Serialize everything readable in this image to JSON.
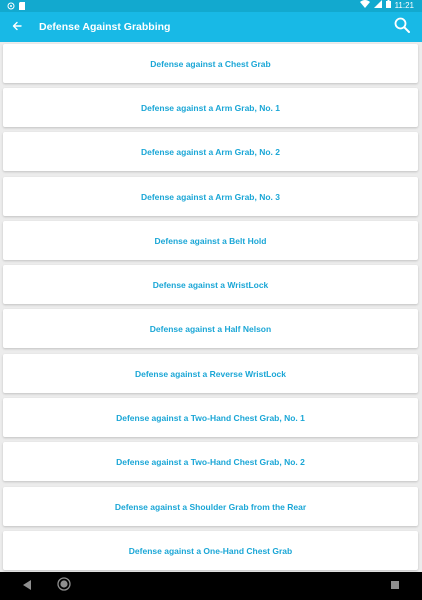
{
  "status_bar": {
    "time": "11:21",
    "icons": [
      "settings-circle-icon",
      "sd-card-icon",
      "wifi-icon",
      "signal-icon",
      "battery-icon"
    ]
  },
  "app_bar": {
    "title": "Defense Against Grabbing",
    "back_icon": "arrow-back-icon",
    "search_icon": "search-icon"
  },
  "list": {
    "items": [
      {
        "label": "Defense against a Chest Grab"
      },
      {
        "label": "Defense against a Arm Grab, No. 1"
      },
      {
        "label": "Defense against a Arm Grab, No. 2"
      },
      {
        "label": "Defense against a Arm Grab, No. 3"
      },
      {
        "label": "Defense against a Belt Hold"
      },
      {
        "label": "Defense against a WristLock"
      },
      {
        "label": "Defense against a Half Nelson"
      },
      {
        "label": "Defense against a Reverse WristLock"
      },
      {
        "label": "Defense against a Two-Hand Chest Grab, No. 1"
      },
      {
        "label": "Defense against a Two-Hand Chest Grab, No. 2"
      },
      {
        "label": "Defense against a Shoulder Grab from the Rear"
      },
      {
        "label": "Defense against a One-Hand Chest Grab"
      }
    ]
  },
  "nav_bar": {
    "icons": [
      "back-triangle-icon",
      "home-circle-icon",
      "recents-square-icon"
    ]
  },
  "colors": {
    "status_bar": "#12a9cf",
    "app_bar": "#18b9e6",
    "item_text": "#1aa6d6",
    "background": "#ececec"
  }
}
